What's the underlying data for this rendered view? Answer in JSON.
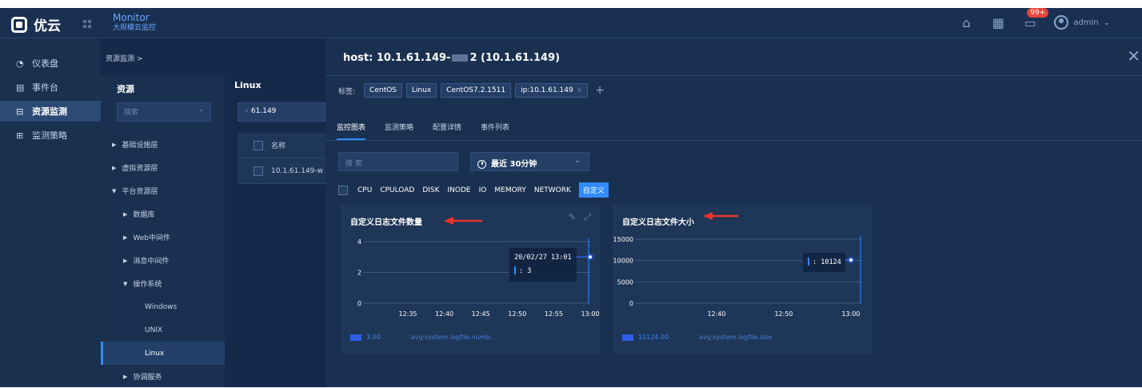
{
  "app": {
    "name": "优云",
    "product": "Monitor",
    "subtitle": "大规模云监控"
  },
  "header": {
    "badge": "99+",
    "user": "admin"
  },
  "sidebar": {
    "items": [
      {
        "label": "仪表盘",
        "icon": "dashboard-icon"
      },
      {
        "label": "事件台",
        "icon": "event-icon"
      },
      {
        "label": "资源监测",
        "icon": "resource-icon"
      },
      {
        "label": "监测策略",
        "icon": "policy-icon"
      }
    ]
  },
  "breadcrumb": "资源监测 >",
  "resources": {
    "title": "资源",
    "search_placeholder": "搜索",
    "tree": [
      {
        "label": "基础设施层",
        "level": 1
      },
      {
        "label": "虚拟资源层",
        "level": 1
      },
      {
        "label": "平台资源层",
        "level": 1
      },
      {
        "label": "数据库",
        "level": 2
      },
      {
        "label": "Web中间件",
        "level": 2
      },
      {
        "label": "消息中间件",
        "level": 2
      },
      {
        "label": "操作系统",
        "level": 2
      },
      {
        "label": "Windows",
        "level": 3
      },
      {
        "label": "UNIX",
        "level": 3
      },
      {
        "label": "Linux",
        "level": 3
      },
      {
        "label": "协调服务",
        "level": 2
      }
    ]
  },
  "list": {
    "title": "Linux",
    "search_value": "61.149",
    "col_name": "名称",
    "row_name": "10.1.61.149-w"
  },
  "detail": {
    "host_prefix": "host: 10.1.61.149-",
    "host_suffix": "2 (10.1.61.149)",
    "tags_label": "标签:",
    "tags": [
      "CentOS",
      "Linux",
      "CentOS7.2.1511",
      "ip:10.1.61.149"
    ],
    "tag_remove": "×",
    "add_tag": "+",
    "tabs": [
      "监控图表",
      "监测策略",
      "配置详情",
      "事件列表"
    ],
    "search_placeholder": "搜 索",
    "time_range": "最近 30分钟",
    "metrics": [
      "CPU",
      "CPULOAD",
      "DISK",
      "INODE",
      "IO",
      "MEMORY",
      "NETWORK"
    ],
    "metric_active": "自定义"
  },
  "colors": {
    "accent": "#2f8cff",
    "series": "#2f5fe6",
    "arrow": "#e8352b"
  },
  "chart_data": [
    {
      "type": "line",
      "title": "自定义日志文件数量",
      "x": [
        "12:35",
        "12:40",
        "12:45",
        "12:50",
        "12:55",
        "13:00"
      ],
      "yticks": [
        "4",
        "2",
        "0"
      ],
      "ylim": [
        0,
        4
      ],
      "series": [
        {
          "name": "avg:system.logfile.numb...",
          "points": [
            [
              "13:00",
              3
            ]
          ]
        }
      ],
      "tooltip": {
        "time": "20/02/27 13:01",
        "value": "3"
      },
      "legend": {
        "value": "3.00",
        "name": "avg:system.logfile.numb..."
      }
    },
    {
      "type": "line",
      "title": "自定义日志文件大小",
      "x": [
        "12:40",
        "12:50",
        "13:00"
      ],
      "yticks": [
        "15000",
        "10000",
        "5000",
        "0"
      ],
      "ylim": [
        0,
        15000
      ],
      "series": [
        {
          "name": "avg:system.logfile.size",
          "points": [
            [
              "13:00",
              10124
            ]
          ]
        }
      ],
      "tooltip": {
        "time": "",
        "value": "10124"
      },
      "legend": {
        "value": "10124.00",
        "name": "avg:system.logfile.size"
      }
    }
  ]
}
